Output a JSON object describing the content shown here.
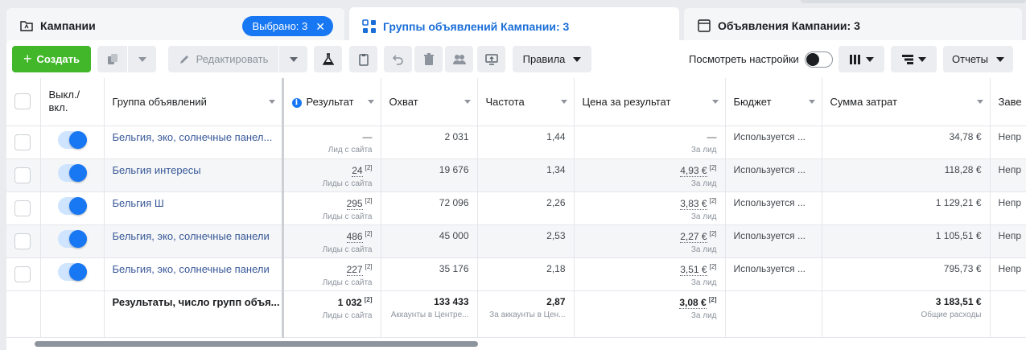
{
  "tabs": {
    "campaigns": {
      "label": "Кампании",
      "selected_badge": "Выбрано: 3"
    },
    "adsets": {
      "label": "Группы объявлений Кампании: 3"
    },
    "ads": {
      "label": "Объявления Кампании: 3"
    }
  },
  "toolbar": {
    "create_label": "Создать",
    "edit_label": "Редактировать",
    "rules_label": "Правила",
    "view_settings_label": "Посмотреть настройки",
    "view_settings_enabled": false,
    "reports_label": "Отчеты"
  },
  "columns": {
    "onoff": "Выкл./ вкл.",
    "name": "Группа объявлений",
    "result": "Результат",
    "reach": "Охват",
    "frequency": "Частота",
    "cost_per_result": "Цена за результат",
    "budget": "Бюджет",
    "spent": "Сумма затрат",
    "ends": "Заве"
  },
  "rows": [
    {
      "enabled": true,
      "name": "Бельгия, эко, солнечные панел...",
      "result": "—",
      "result_sup": "",
      "result_sub": "Лид с сайта",
      "reach": "2 031",
      "frequency": "1,44",
      "cpr": "—",
      "cpr_sup": "",
      "cpr_sub": "За лид",
      "budget": "Используется ...",
      "spent": "34,78 €",
      "ends": "Непр"
    },
    {
      "enabled": true,
      "name": "Бельгия интересы",
      "result": "24",
      "result_sup": "[2]",
      "result_sub": "Лиды с сайта",
      "reach": "19 676",
      "frequency": "1,34",
      "cpr": "4,93 €",
      "cpr_sup": "[2]",
      "cpr_sub": "За лид",
      "budget": "Используется ...",
      "spent": "118,28 €",
      "ends": "Непр"
    },
    {
      "enabled": true,
      "name": "Бельгия Ш",
      "result": "295",
      "result_sup": "[2]",
      "result_sub": "Лиды с сайта",
      "reach": "72 096",
      "frequency": "2,26",
      "cpr": "3,83 €",
      "cpr_sup": "[2]",
      "cpr_sub": "За лид",
      "budget": "Используется ...",
      "spent": "1 129,21 €",
      "ends": "Непр"
    },
    {
      "enabled": true,
      "name": "Бельгия, эко, солнечные панели",
      "result": "486",
      "result_sup": "[2]",
      "result_sub": "Лиды с сайта",
      "reach": "45 000",
      "frequency": "2,53",
      "cpr": "2,27 €",
      "cpr_sup": "[2]",
      "cpr_sub": "За лид",
      "budget": "Используется ...",
      "spent": "1 105,51 €",
      "ends": "Непр"
    },
    {
      "enabled": true,
      "name": "Бельгия, эко, солнечные панели",
      "result": "227",
      "result_sup": "[2]",
      "result_sub": "Лиды с сайта",
      "reach": "35 176",
      "frequency": "2,18",
      "cpr": "3,51 €",
      "cpr_sup": "[2]",
      "cpr_sub": "За лид",
      "budget": "Используется ...",
      "spent": "795,73 €",
      "ends": "Непр"
    }
  ],
  "totals": {
    "label": "Результаты, число групп объя...",
    "result": "1 032",
    "result_sup": "[2]",
    "result_sub": "Лиды с сайта",
    "reach": "133 433",
    "reach_sub": "Аккаунты в Центре...",
    "frequency": "2,87",
    "frequency_sub": "За аккаунты в Цен...",
    "cpr": "3,08 €",
    "cpr_sup": "[2]",
    "cpr_sub": "За лид",
    "spent": "3 183,51 €",
    "spent_sub": "Общие расходы"
  },
  "colors": {
    "accent": "#1877f2",
    "create_green": "#42b72a",
    "link": "#385898"
  }
}
